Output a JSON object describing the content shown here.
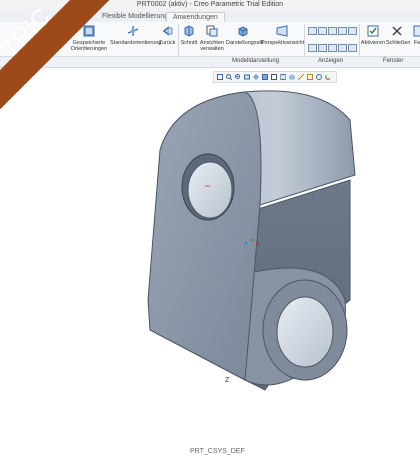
{
  "window": {
    "title": "PRT0002 (aktiv) - Creo Parametric Trial Edition"
  },
  "tabs": [
    {
      "label": "Flexible Modellierung"
    },
    {
      "label": "Anwendungen"
    }
  ],
  "ribbon": {
    "buttons": [
      {
        "label": "Gespeicherte Orientierungen"
      },
      {
        "label": "Standardorientierung"
      },
      {
        "label": "Zurück"
      },
      {
        "label": "Schnitt"
      },
      {
        "label": "Ansichten verwalten"
      },
      {
        "label": "Darstellungsstil"
      },
      {
        "label": "Perspektivansicht"
      },
      {
        "label": "Aktivieren"
      },
      {
        "label": "Schließen"
      },
      {
        "label": "Fe"
      }
    ],
    "groups": [
      {
        "label": "Modelldarstellung"
      },
      {
        "label": "Anzeigen"
      },
      {
        "label": "Fenster"
      }
    ]
  },
  "banner": {
    "text": "TRIC"
  },
  "model": {
    "name": "PRT_CSYS_DEF",
    "axis_label": "Z"
  },
  "colors": {
    "banner": "#9c4a1a",
    "model": "#8c98a8",
    "ribbon_bg": "#f8f9fb"
  }
}
